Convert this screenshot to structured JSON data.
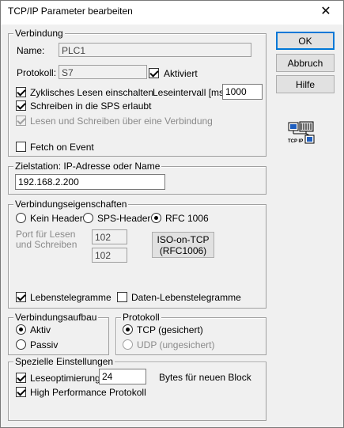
{
  "window": {
    "title": "TCP/IP Parameter bearbeiten",
    "close_glyph": "✕"
  },
  "buttons": {
    "ok": "OK",
    "abort": "Abbruch",
    "help": "Hilfe"
  },
  "tcpip_icon_text": "TCP IP",
  "verbindung": {
    "legend": "Verbindung",
    "name_label": "Name:",
    "name_value": "PLC1",
    "protokoll_label": "Protokoll:",
    "protokoll_value": "S7",
    "aktiviert_label": "Aktiviert",
    "aktiviert_checked": true,
    "zyklisch_label": "Zyklisches Lesen einschalten",
    "zyklisch_checked": true,
    "leseintervall_label": "Leseintervall [ms]:",
    "leseintervall_value": "1000",
    "schreiben_label": "Schreiben in die SPS erlaubt",
    "schreiben_checked": true,
    "lesen_schreiben_label": "Lesen und Schreiben über eine Verbindung",
    "lesen_schreiben_checked": true,
    "fetch_label": "Fetch on Event",
    "fetch_checked": false
  },
  "zielstation": {
    "legend": "Zielstation: IP-Adresse oder Name",
    "value": "192.168.2.200"
  },
  "eigenschaften": {
    "legend": "Verbindungseigenschaften",
    "radio_kein": "Kein Header",
    "radio_sps": "SPS-Header",
    "radio_rfc": "RFC 1006",
    "selected": "rfc",
    "port_label_1": "Port für Lesen",
    "port_label_2": "und Schreiben",
    "port_1": "102",
    "port_2": "102",
    "iso_button_1": "ISO-on-TCP",
    "iso_button_2": "(RFC1006)",
    "lebens_label": "Lebenstelegramme",
    "lebens_checked": true,
    "daten_label": "Daten-Lebenstelegramme",
    "daten_checked": false
  },
  "aufbau": {
    "legend": "Verbindungsaufbau",
    "aktiv": "Aktiv",
    "passiv": "Passiv",
    "selected": "aktiv"
  },
  "protokoll": {
    "legend": "Protokoll",
    "tcp": "TCP (gesichert)",
    "udp": "UDP (ungesichert)",
    "selected": "tcp"
  },
  "spezielle": {
    "legend": "Spezielle Einstellungen",
    "leseopt_label": "Leseoptimierung",
    "leseopt_checked": true,
    "leseopt_value": "24",
    "bytes_label": "Bytes für neuen Block",
    "high_perf_label": "High Performance Protokoll",
    "high_perf_checked": true
  }
}
